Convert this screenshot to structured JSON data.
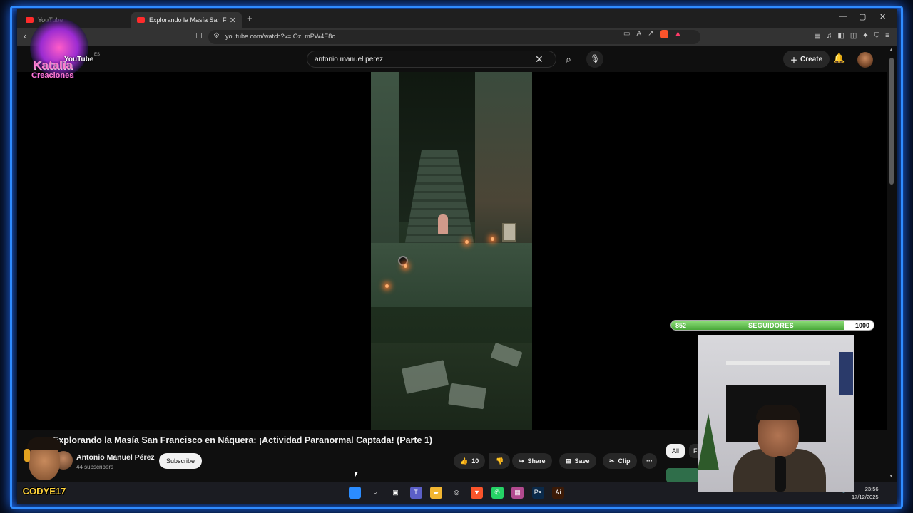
{
  "browser": {
    "tabs": [
      {
        "label": "YouTube",
        "active": false
      },
      {
        "label": "Explorando la Masía San Francis",
        "active": true
      }
    ],
    "new_tab": "+",
    "window_controls": [
      "—",
      "▢",
      "✕"
    ],
    "url": "youtube.com/watch?v=IOzLmPW4E8c"
  },
  "youtube": {
    "search_value": "antonio manuel perez",
    "create_label": "Create",
    "video": {
      "title": "Explorando la Masía San Francisco en Náquera: ¡Actividad Paranormal Captada! (Parte 1)",
      "channel": "Antonio Manuel Pérez",
      "subscribers": "44 subscribers",
      "subscribe_label": "Subscribe",
      "likes": "10",
      "share_label": "Share",
      "save_label": "Save",
      "clip_label": "Clip",
      "more": "···"
    },
    "chips": [
      "All",
      "F"
    ]
  },
  "overlay": {
    "logo_line1": "Katalia",
    "logo_line2": "Creaciones",
    "logo_yt": "YouTube",
    "logo_lang": "ES",
    "followers": {
      "current": "852",
      "label": "SEGUIDORES",
      "goal": "1000",
      "progress": 0.852
    },
    "streamer_name": "CODYE17"
  },
  "taskbar": {
    "apps": [
      {
        "name": "windows-start",
        "glyph": "",
        "color": "#2b8cff"
      },
      {
        "name": "search",
        "glyph": "⌕",
        "color": "#1b1c22"
      },
      {
        "name": "task-view",
        "glyph": "▣",
        "color": "#1b1c22"
      },
      {
        "name": "teams",
        "glyph": "T",
        "color": "#5b5fc7"
      },
      {
        "name": "file-explorer",
        "glyph": "▰",
        "color": "#f2b632"
      },
      {
        "name": "chrome",
        "glyph": "◎",
        "color": "#1b1c22"
      },
      {
        "name": "brave",
        "glyph": "▼",
        "color": "#fb542b"
      },
      {
        "name": "whatsapp",
        "glyph": "✆",
        "color": "#25d366"
      },
      {
        "name": "winrar",
        "glyph": "▦",
        "color": "#b24a8f"
      },
      {
        "name": "photoshop",
        "glyph": "Ps",
        "color": "#0b2a4a"
      },
      {
        "name": "illustrator",
        "glyph": "Ai",
        "color": "#3b1a07"
      }
    ],
    "tray_lang": "LAA",
    "time": "23:56",
    "date": "17/12/2025"
  },
  "colors": {
    "accent_glow": "#2f8cff",
    "follow_fill": "#4aa83a",
    "yt_red": "#ff0000"
  }
}
